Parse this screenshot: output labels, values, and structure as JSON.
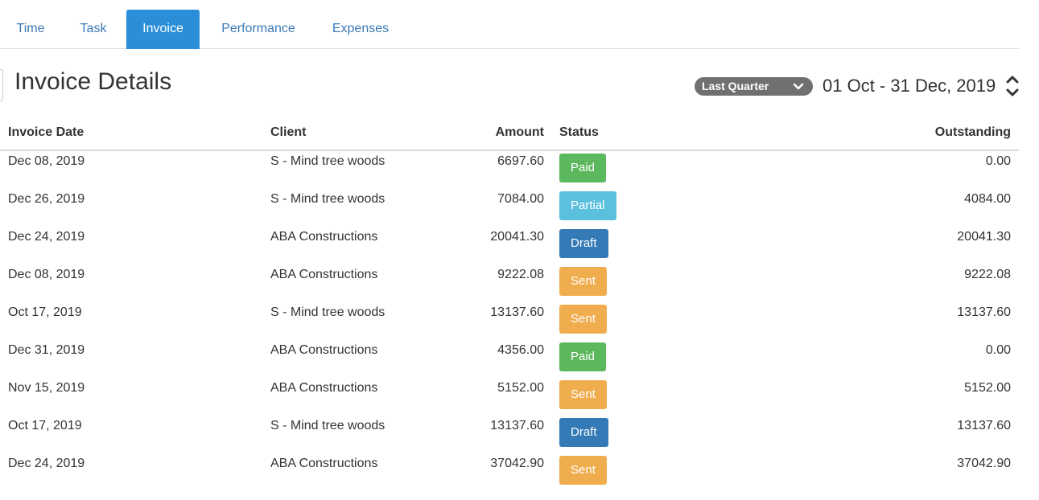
{
  "tabs": [
    {
      "label": "Time",
      "active": false
    },
    {
      "label": "Task",
      "active": false
    },
    {
      "label": "Invoice",
      "active": true
    },
    {
      "label": "Performance",
      "active": false
    },
    {
      "label": "Expenses",
      "active": false
    }
  ],
  "header": {
    "title": "Invoice Details",
    "range_select": "Last Quarter",
    "date_range": "01 Oct - 31 Dec, 2019"
  },
  "table": {
    "columns": {
      "invoice_date": "Invoice Date",
      "client": "Client",
      "amount": "Amount",
      "status": "Status",
      "outstanding": "Outstanding"
    },
    "rows": [
      {
        "date": "Dec 08, 2019",
        "client": "S - Mind tree woods",
        "amount": "6697.60",
        "status": "Paid",
        "outstanding": "0.00"
      },
      {
        "date": "Dec 26, 2019",
        "client": "S - Mind tree woods",
        "amount": "7084.00",
        "status": "Partial",
        "outstanding": "4084.00"
      },
      {
        "date": "Dec 24, 2019",
        "client": "ABA Constructions",
        "amount": "20041.30",
        "status": "Draft",
        "outstanding": "20041.30"
      },
      {
        "date": "Dec 08, 2019",
        "client": "ABA Constructions",
        "amount": "9222.08",
        "status": "Sent",
        "outstanding": "9222.08"
      },
      {
        "date": "Oct 17, 2019",
        "client": "S - Mind tree woods",
        "amount": "13137.60",
        "status": "Sent",
        "outstanding": "13137.60"
      },
      {
        "date": "Dec 31, 2019",
        "client": "ABA Constructions",
        "amount": "4356.00",
        "status": "Paid",
        "outstanding": "0.00"
      },
      {
        "date": "Nov 15, 2019",
        "client": "ABA Constructions",
        "amount": "5152.00",
        "status": "Sent",
        "outstanding": "5152.00"
      },
      {
        "date": "Oct 17, 2019",
        "client": "S - Mind tree woods",
        "amount": "13137.60",
        "status": "Draft",
        "outstanding": "13137.60"
      },
      {
        "date": "Dec 24, 2019",
        "client": "ABA Constructions",
        "amount": "37042.90",
        "status": "Sent",
        "outstanding": "37042.90"
      }
    ]
  },
  "status_colors": {
    "Paid": "#5cb85c",
    "Partial": "#5bc0de",
    "Draft": "#337ab7",
    "Sent": "#f0ad4e"
  },
  "icons": {
    "range_chevron": "chevron-down-icon",
    "date_spinner": "up-down-arrows-icon"
  }
}
